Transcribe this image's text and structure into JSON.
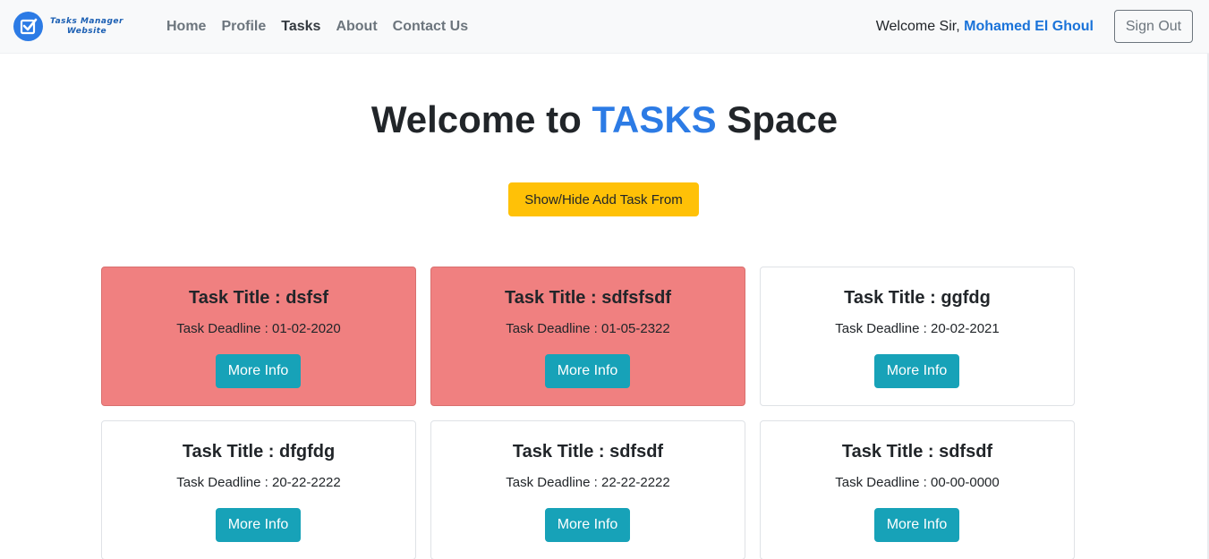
{
  "brand": {
    "logo_icon": "checkbox-check-icon",
    "line1": "Tasks Manager",
    "line2": "Website"
  },
  "nav": {
    "items": [
      {
        "label": "Home"
      },
      {
        "label": "Profile"
      },
      {
        "label": "Tasks"
      },
      {
        "label": "About"
      },
      {
        "label": "Contact Us"
      }
    ],
    "active": "Tasks"
  },
  "user": {
    "greeting": "Welcome Sir, ",
    "name": "Mohamed El Ghoul",
    "signout_label": "Sign Out"
  },
  "hero": {
    "prefix": "Welcome to ",
    "highlight": "TASKS",
    "suffix": " Space"
  },
  "toggle_button_label": "Show/Hide Add Task From",
  "tasks": [
    {
      "title": "Task Title : dsfsf",
      "deadline": "Task Deadline : 01-02-2020",
      "button": "More Info",
      "status": "overdue"
    },
    {
      "title": "Task Title : sdfsfsdf",
      "deadline": "Task Deadline : 01-05-2322",
      "button": "More Info",
      "status": "overdue"
    },
    {
      "title": "Task Title : ggfdg",
      "deadline": "Task Deadline : 20-02-2021",
      "button": "More Info",
      "status": "normal"
    },
    {
      "title": "Task Title : dfgfdg",
      "deadline": "Task Deadline : 20-22-2222",
      "button": "More Info",
      "status": "normal"
    },
    {
      "title": "Task Title : sdfsdf",
      "deadline": "Task Deadline : 22-22-2222",
      "button": "More Info",
      "status": "normal"
    },
    {
      "title": "Task Title : sdfsdf",
      "deadline": "Task Deadline : 00-00-0000",
      "button": "More Info",
      "status": "normal"
    }
  ],
  "colors": {
    "accent": "#2c7be5",
    "overdue_card": "#f08080",
    "info_button": "#17a2b8",
    "warning_button": "#ffc107"
  }
}
